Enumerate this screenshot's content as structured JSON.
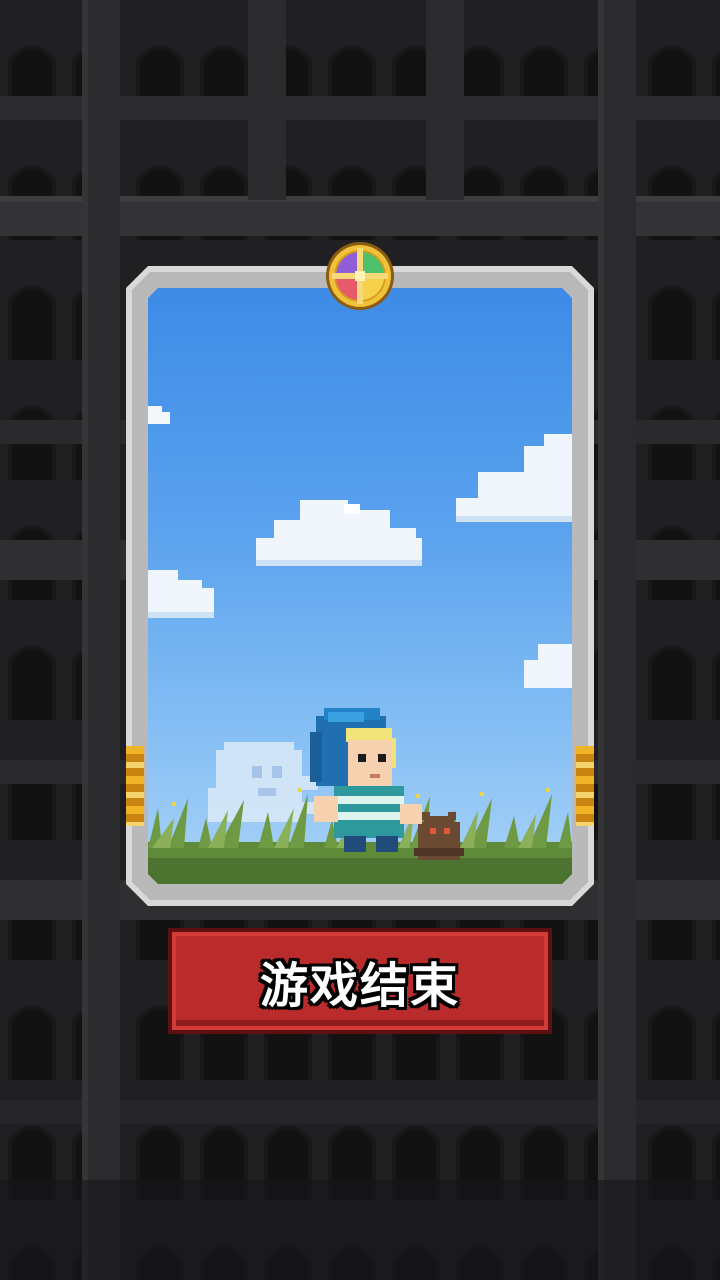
{
  "screen": {
    "background_color": "#1f1f20"
  },
  "card": {
    "frame_color": "#d9d9d9",
    "sky_top_color": "#3d8be6",
    "sky_bottom_color": "#a9d3f7",
    "grass_color": "#5e8a3a",
    "medallion_icon": "four-quadrant-emblem-icon",
    "character_icon": "hooded-hero-icon",
    "companion_icon": "brown-creature-icon",
    "ghost_icon": "cloud-ghost-icon"
  },
  "button": {
    "label": "游戏结束",
    "color": "#ba2c2c"
  }
}
